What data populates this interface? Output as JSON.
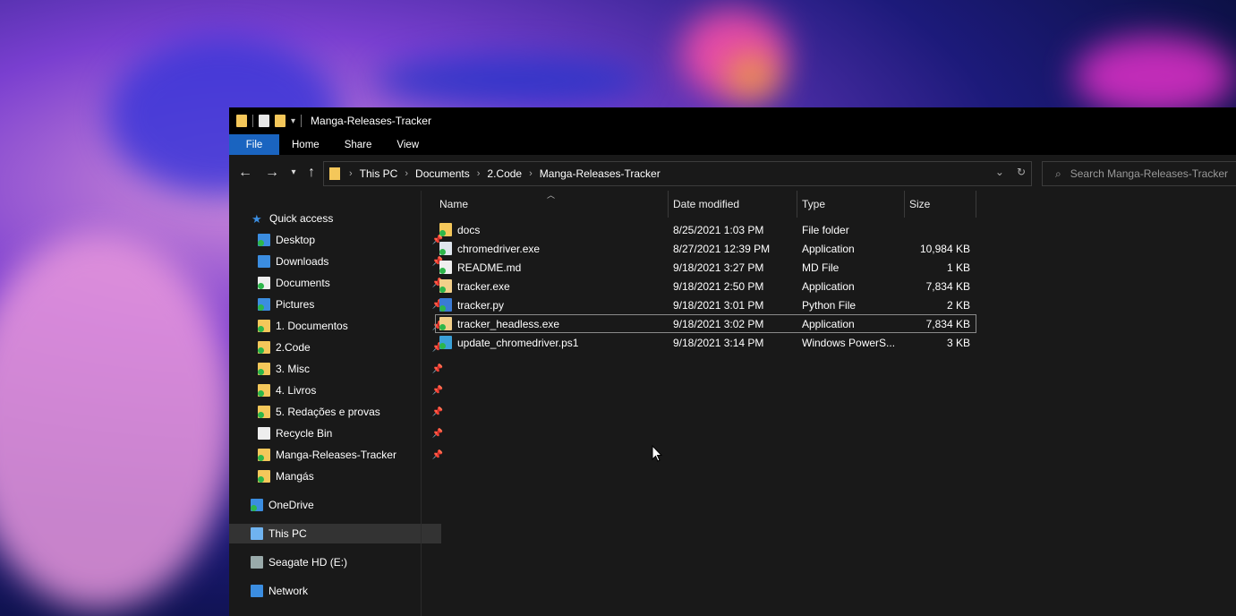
{
  "window": {
    "title": "Manga-Releases-Tracker"
  },
  "ribbon": {
    "tabs": [
      "File",
      "Home",
      "Share",
      "View"
    ]
  },
  "address": {
    "crumbs": [
      "This PC",
      "Documents",
      "2.Code",
      "Manga-Releases-Tracker"
    ],
    "search_placeholder": "Search Manga-Releases-Tracker"
  },
  "sidebar": {
    "quick_access": "Quick access",
    "items": [
      "Desktop",
      "Downloads",
      "Documents",
      "Pictures",
      "1. Documentos",
      "2.Code",
      "3. Misc",
      "4. Livros",
      "5. Redações e provas",
      "Recycle Bin",
      "Manga-Releases-Tracker",
      "Mangás"
    ],
    "onedrive": "OneDrive",
    "this_pc": "This PC",
    "seagate": "Seagate HD (E:)",
    "network": "Network"
  },
  "columns": {
    "name": "Name",
    "date": "Date modified",
    "type": "Type",
    "size": "Size"
  },
  "files": [
    {
      "name": "docs",
      "date": "8/25/2021 1:03 PM",
      "type": "File folder",
      "size": ""
    },
    {
      "name": "chromedriver.exe",
      "date": "8/27/2021 12:39 PM",
      "type": "Application",
      "size": "10,984 KB"
    },
    {
      "name": "README.md",
      "date": "9/18/2021 3:27 PM",
      "type": "MD File",
      "size": "1 KB"
    },
    {
      "name": "tracker.exe",
      "date": "9/18/2021 2:50 PM",
      "type": "Application",
      "size": "7,834 KB"
    },
    {
      "name": "tracker.py",
      "date": "9/18/2021 3:01 PM",
      "type": "Python File",
      "size": "2 KB"
    },
    {
      "name": "tracker_headless.exe",
      "date": "9/18/2021 3:02 PM",
      "type": "Application",
      "size": "7,834 KB"
    },
    {
      "name": "update_chromedriver.ps1",
      "date": "9/18/2021 3:14 PM",
      "type": "Windows PowerS...",
      "size": "3 KB"
    }
  ],
  "colors": {
    "file_tab": "#1a64c0",
    "window_bg": "#191919",
    "titlebar": "#000000"
  }
}
